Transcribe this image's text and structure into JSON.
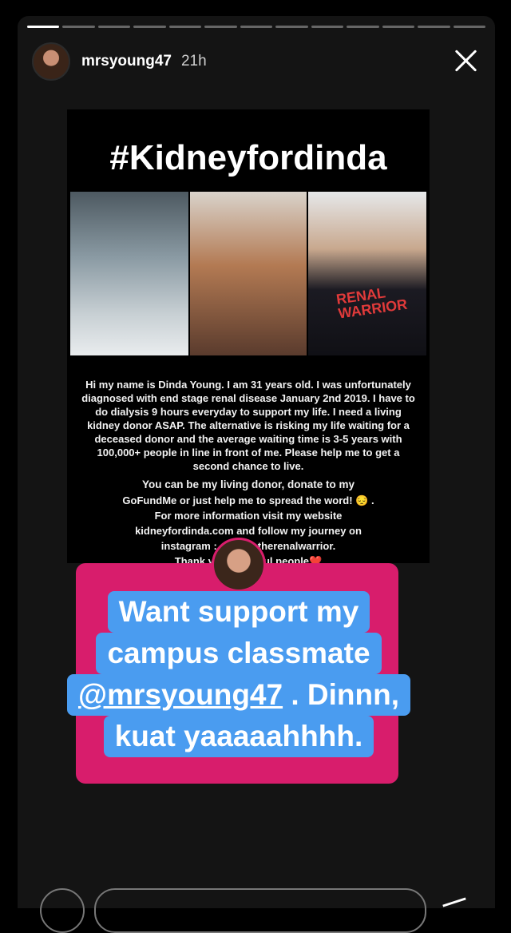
{
  "story": {
    "progress_segments": 13,
    "progress_current": 1,
    "username": "mrsyoung47",
    "time_ago": "21h"
  },
  "poster": {
    "title": "#Kidneyfordinda",
    "jersey_text": "RENAL WARRIOR",
    "paragraph1": "Hi my name is Dinda Young. I am 31 years old. I was unfortunately diagnosed with end stage renal disease January 2nd 2019. I have to do dialysis 9 hours everyday to support my life. I need a living kidney donor ASAP. The alternative is risking my life waiting for a deceased donor and the average waiting time is 3-5 years with 100,000+ people in line in front of me. Please help me to get a second chance to live.",
    "paragraph2_line1": "You can be my living donor, donate to my",
    "paragraph2_line2": "GoFundMe or just help me to spread the word! 😔 .",
    "paragraph2_line3": "For more information visit my website",
    "paragraph2_line4": "kidneyfordinda.com and follow my journey on",
    "paragraph2_line5": "instagram : @dindatherenalwarrior.",
    "paragraph2_line6": "Thank you beautiful people❤️"
  },
  "caption": {
    "line1": "Want support my",
    "line2": "campus classmate",
    "mention": "@mrsyoung47",
    "line3_rest": " . Dinnn,",
    "line4": "kuat yaaaaahhhh."
  },
  "colors": {
    "sticker_pink": "#d81d6c",
    "caption_blue": "#4a9cf0"
  }
}
